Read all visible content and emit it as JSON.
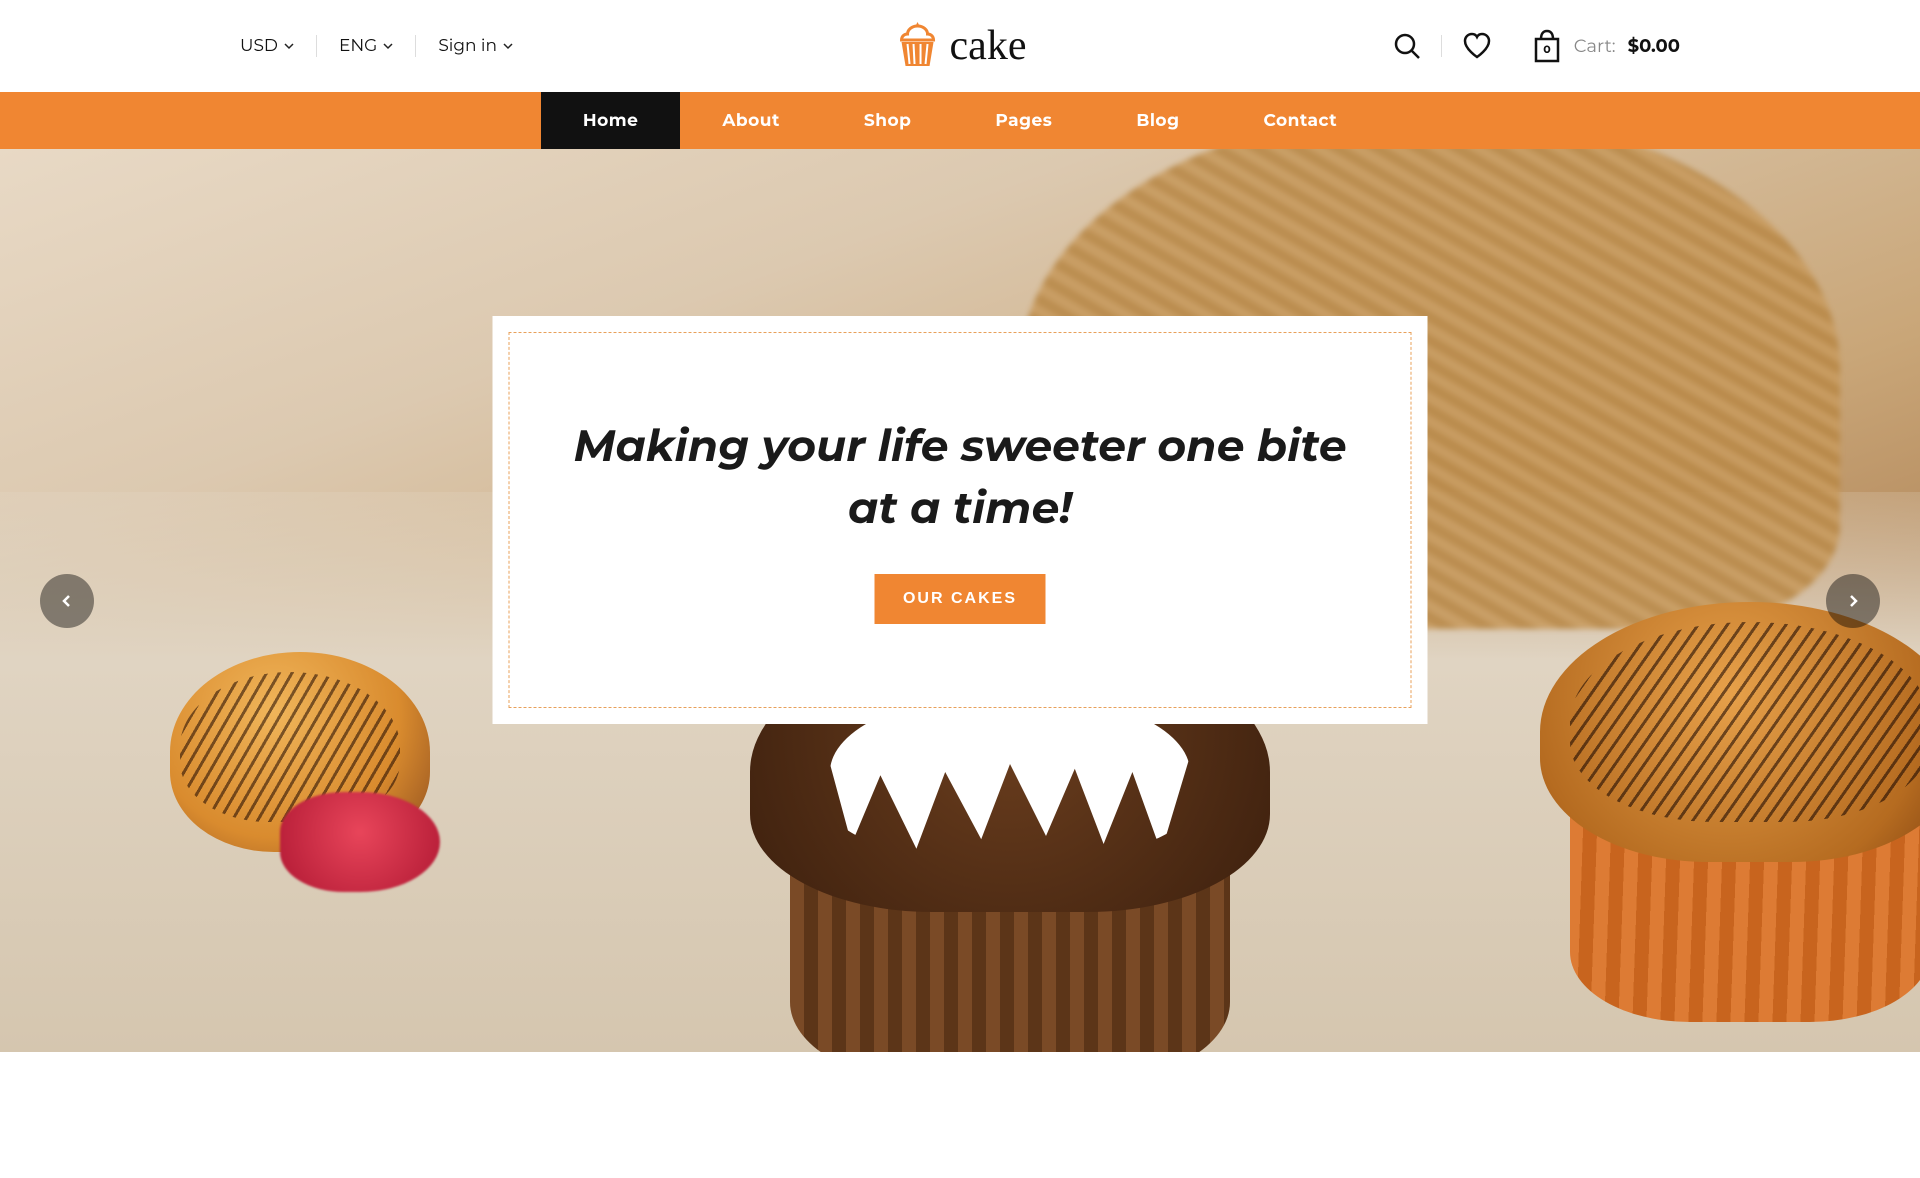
{
  "topbar": {
    "currency": "USD",
    "language": "ENG",
    "signin": "Sign in"
  },
  "logo": {
    "text": "cake"
  },
  "cart": {
    "label": "Cart:",
    "price": "$0.00",
    "count": "0"
  },
  "nav": {
    "items": [
      {
        "label": "Home",
        "active": true
      },
      {
        "label": "About",
        "active": false
      },
      {
        "label": "Shop",
        "active": false
      },
      {
        "label": "Pages",
        "active": false
      },
      {
        "label": "Blog",
        "active": false
      },
      {
        "label": "Contact",
        "active": false
      }
    ]
  },
  "hero": {
    "title": "Making your life sweeter one bite at a time!",
    "button": "OUR CAKES"
  },
  "colors": {
    "accent": "#f08632"
  }
}
